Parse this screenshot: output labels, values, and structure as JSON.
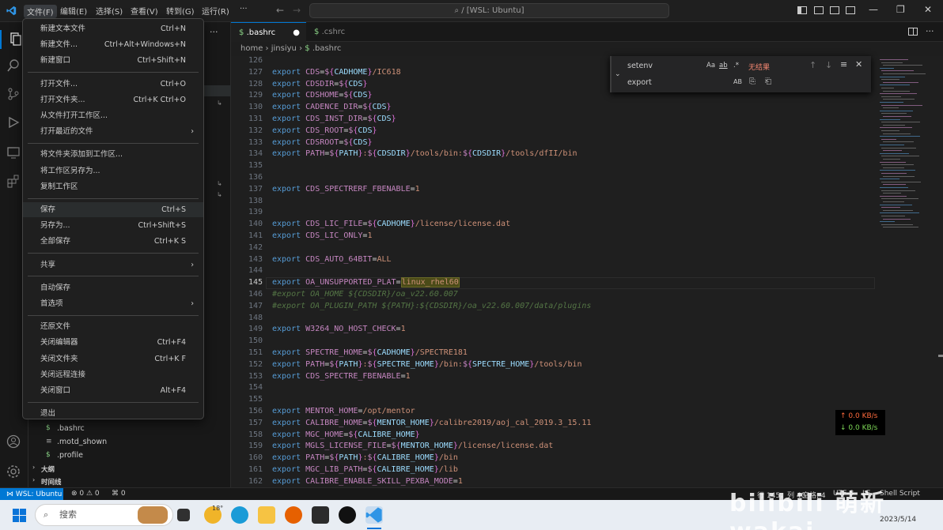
{
  "titlebar": {
    "menus": [
      "文件(F)",
      "编辑(E)",
      "选择(S)",
      "查看(V)",
      "转到(G)",
      "运行(R)",
      "···"
    ],
    "command_center": "/ [WSL: Ubuntu]"
  },
  "tabs": [
    {
      "label": ".bashrc",
      "prefix": "$",
      "modified_dot": "●"
    },
    {
      "label": ".cshrc",
      "prefix": "$"
    }
  ],
  "breadcrumb": {
    "parts": [
      "home",
      "jinsiyu",
      ".bashrc"
    ],
    "file_prefix": "$"
  },
  "find_widget": {
    "find_value": "setenv",
    "replace_value": "export",
    "status": "无结果",
    "toggles": [
      "Aa",
      "ab",
      ".*"
    ],
    "replace_toggle": "AB"
  },
  "code_lines": [
    {
      "n": "126",
      "text": ""
    },
    {
      "n": "127",
      "text": "export CDS=${CADHOME}/IC618"
    },
    {
      "n": "128",
      "text": "export CDSDIR=${CDS}"
    },
    {
      "n": "129",
      "text": "export CDSHOME=${CDS}"
    },
    {
      "n": "130",
      "text": "export CADENCE_DIR=${CDS}"
    },
    {
      "n": "131",
      "text": "export CDS_INST_DIR=${CDS}"
    },
    {
      "n": "132",
      "text": "export CDS_ROOT=${CDS}"
    },
    {
      "n": "133",
      "text": "export CDSROOT=${CDS}"
    },
    {
      "n": "134",
      "text": "export PATH=${PATH}:${CDSDIR}/tools/bin:${CDSDIR}/tools/dfII/bin"
    },
    {
      "n": "135",
      "text": ""
    },
    {
      "n": "136",
      "text": ""
    },
    {
      "n": "137",
      "text": "export CDS_SPECTRERF_FBENABLE=1"
    },
    {
      "n": "138",
      "text": ""
    },
    {
      "n": "139",
      "text": ""
    },
    {
      "n": "140",
      "text": "export CDS_LIC_FILE=${CADHOME}/license/license.dat"
    },
    {
      "n": "141",
      "text": "export CDS_LIC_ONLY=1"
    },
    {
      "n": "142",
      "text": ""
    },
    {
      "n": "143",
      "text": "export CDS_AUTO_64BIT=ALL"
    },
    {
      "n": "144",
      "text": ""
    },
    {
      "n": "145",
      "text": "export OA_UNSUPPORTED_PLAT=",
      "highlight": "linux_rhel60"
    },
    {
      "n": "146",
      "text": "#export OA_HOME ${CDSDIR}/oa_v22.60.007",
      "comment": true
    },
    {
      "n": "147",
      "text": "#export OA_PLUGIN_PATH ${PATH}:${CDSDIR}/oa_v22.60.007/data/plugins",
      "comment": true
    },
    {
      "n": "148",
      "text": ""
    },
    {
      "n": "149",
      "text": "export W3264_NO_HOST_CHECK=1"
    },
    {
      "n": "150",
      "text": ""
    },
    {
      "n": "151",
      "text": "export SPECTRE_HOME=${CADHOME}/SPECTRE181"
    },
    {
      "n": "152",
      "text": "export PATH=${PATH}:${SPECTRE_HOME}/bin:${SPECTRE_HOME}/tools/bin"
    },
    {
      "n": "153",
      "text": "export CDS_SPECTRE_FBENABLE=1"
    },
    {
      "n": "154",
      "text": ""
    },
    {
      "n": "155",
      "text": ""
    },
    {
      "n": "156",
      "text": "export MENTOR_HOME=/opt/mentor"
    },
    {
      "n": "157",
      "text": "export CALIBRE_HOME=${MENTOR_HOME}/calibre2019/aoj_cal_2019.3_15.11"
    },
    {
      "n": "158",
      "text": "export MGC_HOME=${CALIBRE_HOME}"
    },
    {
      "n": "159",
      "text": "export MGLS_LICENSE_FILE=${MENTOR_HOME}/license/license.dat"
    },
    {
      "n": "160",
      "text": "export PATH=${PATH}:${CALIBRE_HOME}/bin"
    },
    {
      "n": "161",
      "text": "export MGC_LIB_PATH=${CALIBRE_HOME}/lib"
    },
    {
      "n": "162",
      "text": "export CALIBRE_ENABLE_SKILL_PEXBA_MODE=1"
    }
  ],
  "file_menu": {
    "groups": [
      [
        {
          "label": "新建文本文件",
          "shortcut": "Ctrl+N"
        },
        {
          "label": "新建文件...",
          "shortcut": "Ctrl+Alt+Windows+N"
        },
        {
          "label": "新建窗口",
          "shortcut": "Ctrl+Shift+N"
        }
      ],
      [
        {
          "label": "打开文件...",
          "shortcut": "Ctrl+O"
        },
        {
          "label": "打开文件夹...",
          "shortcut": "Ctrl+K Ctrl+O"
        },
        {
          "label": "从文件打开工作区...",
          "shortcut": ""
        },
        {
          "label": "打开最近的文件",
          "shortcut": "",
          "submenu": true
        }
      ],
      [
        {
          "label": "将文件夹添加到工作区...",
          "shortcut": ""
        },
        {
          "label": "将工作区另存为...",
          "shortcut": ""
        },
        {
          "label": "复制工作区",
          "shortcut": ""
        }
      ],
      [
        {
          "label": "保存",
          "shortcut": "Ctrl+S",
          "hover": true
        },
        {
          "label": "另存为...",
          "shortcut": "Ctrl+Shift+S"
        },
        {
          "label": "全部保存",
          "shortcut": "Ctrl+K S"
        }
      ],
      [
        {
          "label": "共享",
          "shortcut": "",
          "submenu": true
        }
      ],
      [
        {
          "label": "自动保存",
          "shortcut": ""
        },
        {
          "label": "首选项",
          "shortcut": "",
          "submenu": true
        }
      ],
      [
        {
          "label": "还原文件",
          "shortcut": ""
        },
        {
          "label": "关闭编辑器",
          "shortcut": "Ctrl+F4"
        },
        {
          "label": "关闭文件夹",
          "shortcut": "Ctrl+K F"
        },
        {
          "label": "关闭远程连接",
          "shortcut": ""
        },
        {
          "label": "关闭窗口",
          "shortcut": "Alt+F4"
        }
      ],
      [
        {
          "label": "退出",
          "shortcut": ""
        }
      ]
    ]
  },
  "explorer": {
    "files": [
      {
        "name": ".bashrc",
        "icon": "$"
      },
      {
        "name": ".motd_shown",
        "icon": "≡"
      },
      {
        "name": ".profile",
        "icon": "$"
      }
    ],
    "sections": [
      "大纲",
      "时间线"
    ]
  },
  "statusbar": {
    "remote": "WSL: Ubuntu",
    "problems": "⊗ 0 ⚠ 0",
    "ports": "⌘ 0",
    "position": "行 145，列 40",
    "indent": "空格: 4",
    "encoding": "UTF-8",
    "eol": "LF",
    "language": "Shell Script"
  },
  "net": {
    "up": "↑ 0.0 KB/s",
    "down": "↓ 0.0 KB/s"
  },
  "taskbar": {
    "search_placeholder": "搜索",
    "weather_temp": "18°",
    "date": "2023/5/14"
  },
  "watermark": "bilibili 萌新wakai",
  "colors": {
    "accent": "#0078d4",
    "keyword": "#569cd6",
    "variable": "#c586c0",
    "string": "#ce9178",
    "comment": "#6a9955"
  }
}
